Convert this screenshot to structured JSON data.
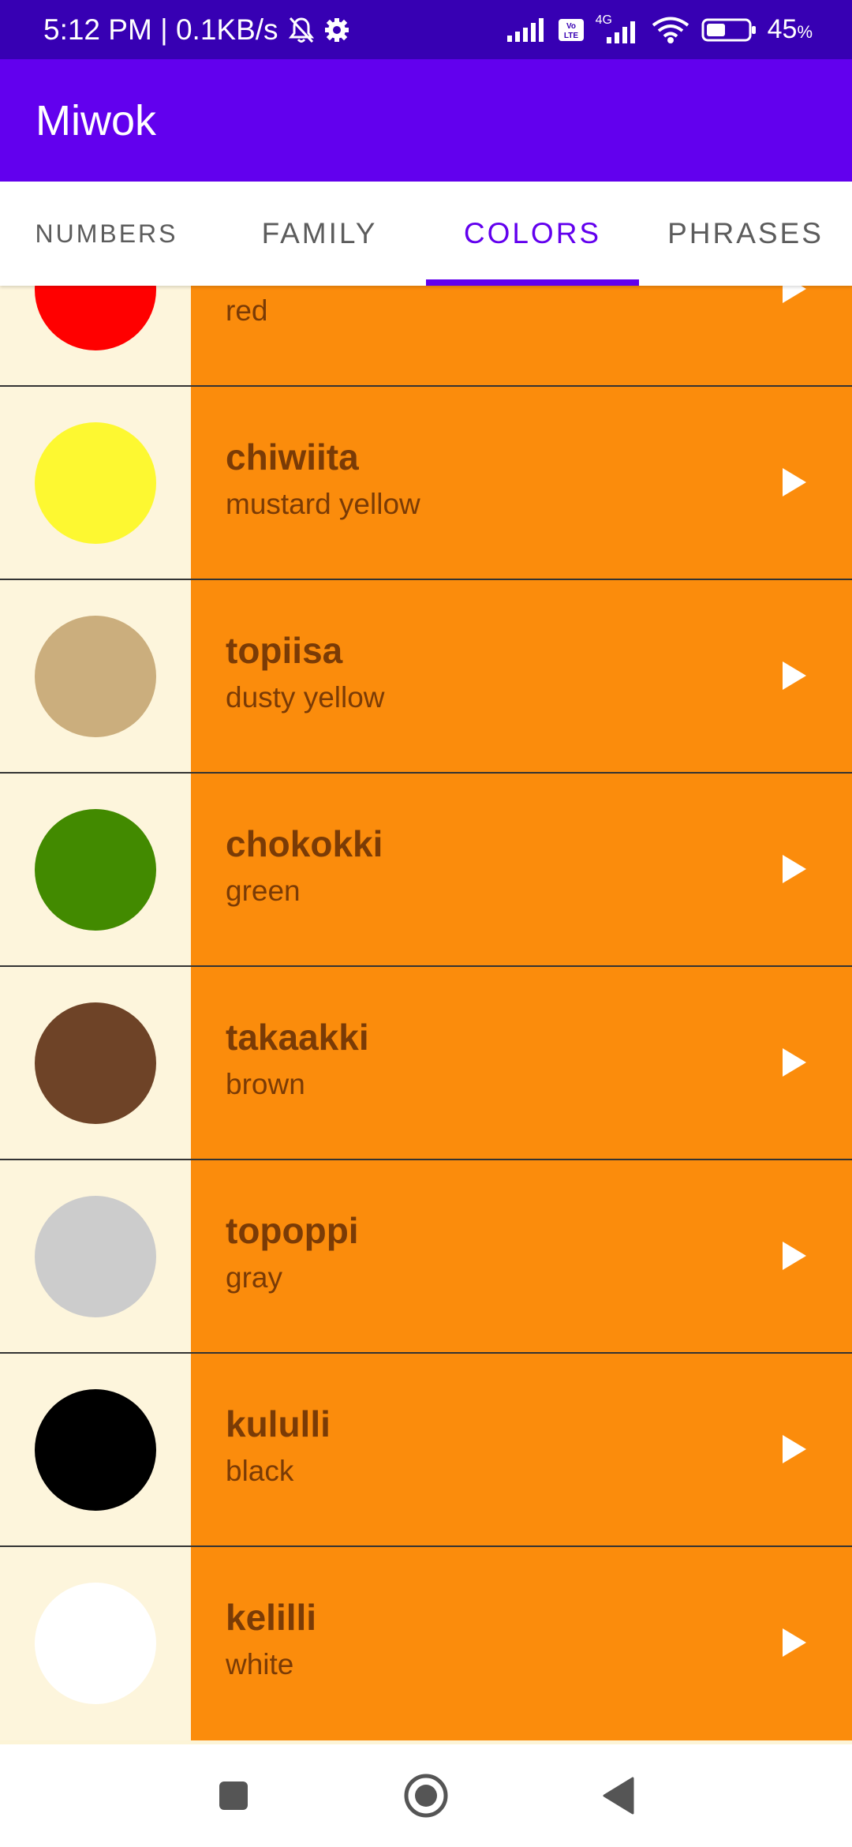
{
  "status_bar": {
    "time_speed": "5:12 PM | 0.1KB/s",
    "network_4g": "4G",
    "volte": "Vo LTE",
    "battery_pct": "45",
    "battery_unit": "%",
    "battery_level": 0.45
  },
  "app": {
    "title": "Miwok"
  },
  "tabs": [
    {
      "label": "NUMBERS",
      "selected": false
    },
    {
      "label": "FAMILY",
      "selected": false
    },
    {
      "label": "COLORS",
      "selected": true
    },
    {
      "label": "PHRASES",
      "selected": false
    }
  ],
  "colors": {
    "primary": "#6200EE",
    "primary_dark": "#3700B3",
    "item_background": "#FB8C0C",
    "text_color": "#7A3B06"
  },
  "items": [
    {
      "miwok": "",
      "english": "red",
      "swatch": "#FF0000"
    },
    {
      "miwok": "chiwiita",
      "english": "mustard yellow",
      "swatch": "#FDF831"
    },
    {
      "miwok": "topiisa",
      "english": "dusty yellow",
      "swatch": "#CBAE7D"
    },
    {
      "miwok": "chokokki",
      "english": "green",
      "swatch": "#428A00"
    },
    {
      "miwok": "takaakki",
      "english": "brown",
      "swatch": "#6E4327"
    },
    {
      "miwok": "topoppi",
      "english": "gray",
      "swatch": "#CCCCCC"
    },
    {
      "miwok": "kululli",
      "english": "black",
      "swatch": "#000000"
    },
    {
      "miwok": "kelilli",
      "english": "white",
      "swatch": "#FFFFFF"
    }
  ],
  "icons": {
    "play": "play-icon",
    "recents": "square-icon",
    "home": "circle-icon",
    "back": "triangle-back-icon"
  }
}
